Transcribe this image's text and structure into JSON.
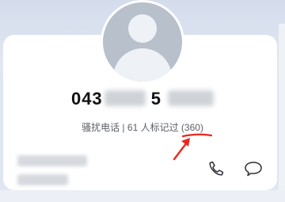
{
  "contact": {
    "number_prefix": "043",
    "number_visible": "5",
    "tag_label": "骚扰电话",
    "separator": "|",
    "reports_text": "61 人标记过",
    "source": "(360)"
  },
  "icons": {
    "avatar": "default-avatar-icon",
    "call": "phone-icon",
    "message": "message-bubble-icon",
    "annotation": "red-arrow-annotation"
  },
  "colors": {
    "annotation": "#e8281f",
    "avatar_bg": "#b7c0cb",
    "background": "#dfe6f2"
  }
}
